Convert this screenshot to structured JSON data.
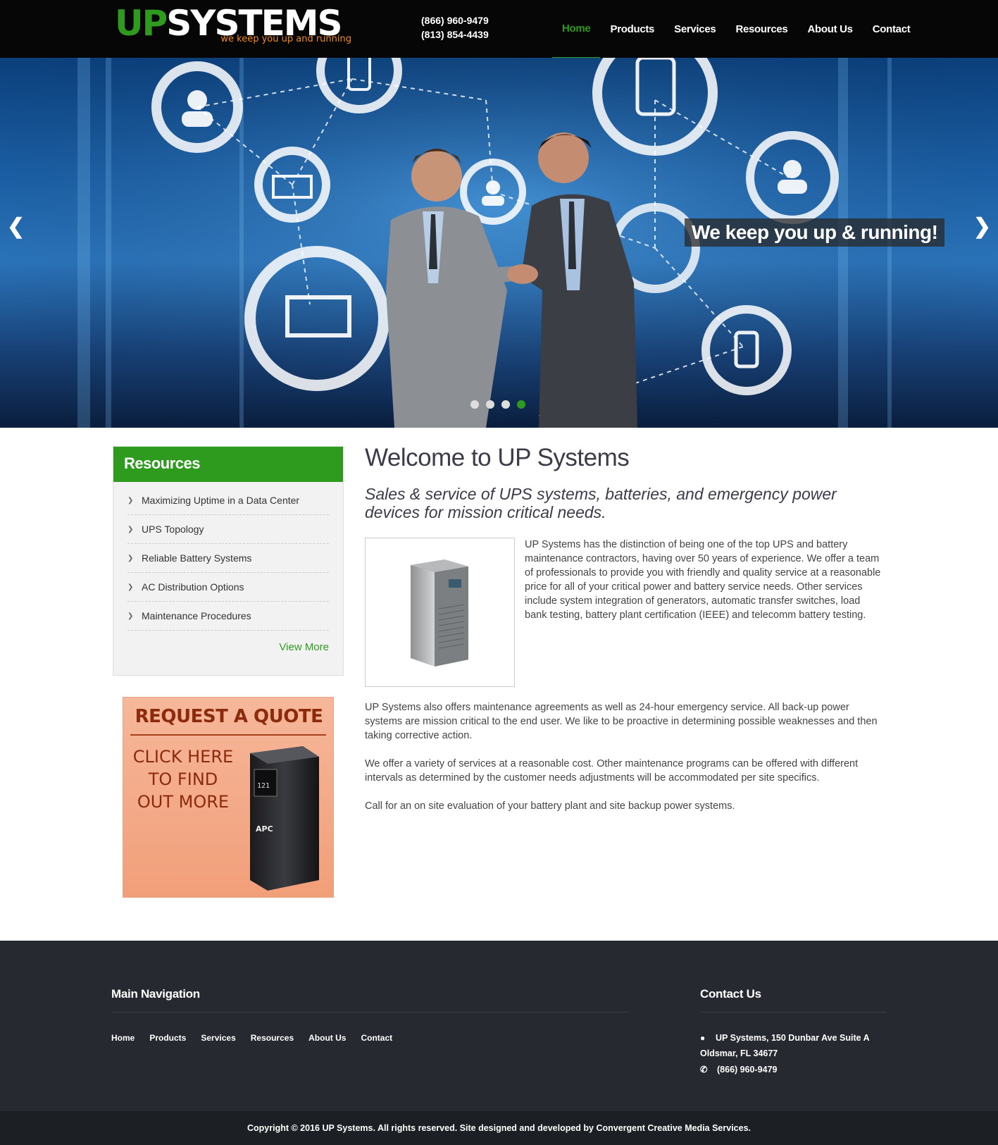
{
  "header": {
    "logo_up": "UP",
    "logo_systems": "SYSTEMS",
    "logo_tagline": "we keep you up and running",
    "phone_1": "(866) 960-9479",
    "phone_2": "(813) 854-4439",
    "nav": [
      "Home",
      "Products",
      "Services",
      "Resources",
      "About Us",
      "Contact"
    ],
    "active_nav": "Home"
  },
  "hero": {
    "caption": "We keep you up & running!",
    "prev_icon": "chevron-left-icon",
    "next_icon": "chevron-right-icon",
    "slide_count": 4,
    "active_slide": 4
  },
  "sidebar": {
    "resources_title": "Resources",
    "resources": [
      "Maximizing Uptime in a Data Center",
      "UPS Topology",
      "Reliable Battery Systems",
      "AC Distribution Options",
      "Maintenance Procedures"
    ],
    "view_more": "View More",
    "quote_title": "REQUEST A QUOTE",
    "quote_cta": "CLICK HERE TO FIND OUT MORE",
    "quote_cta_lines": [
      "CLICK HERE",
      "TO FIND",
      "OUT MORE"
    ]
  },
  "main": {
    "title": "Welcome to UP Systems",
    "subtitle": "Sales & service of UPS systems, batteries, and emergency power devices for mission critical needs.",
    "intro": "UP Systems has the distinction of being one of the top UPS and battery maintenance contractors, having over 50 years of experience. We offer a team of professionals to provide you with friendly and quality service at a reasonable price for all of your critical power and battery service needs. Other services include system integration of generators, automatic transfer switches, load bank testing, battery plant certification (IEEE) and telecomm battery testing.",
    "paragraphs": [
      "UP Systems also offers maintenance agreements as well as 24-hour emergency service. All back-up power systems are mission critical to the end user. We like to be proactive in determining possible weaknesses and then taking corrective action.",
      "We offer a variety of services at a reasonable cost. Other maintenance programs can be offered with different intervals as determined by the customer needs adjustments will be accommodated per site specifics.",
      "Call for an on site evaluation of your battery plant and site backup power systems."
    ]
  },
  "footer": {
    "main_nav_title": "Main Navigation",
    "nav": [
      "Home",
      "Products",
      "Services",
      "Resources",
      "About Us",
      "Contact"
    ],
    "contact_title": "Contact Us",
    "address_line_1": "UP Systems, 150 Dunbar Ave Suite A",
    "address_line_2": "Oldsmar, FL 34677",
    "phone": "(866) 960-9479",
    "copyright": "Copyright © 2016 UP Systems. All rights reserved. Site designed and developed by Convergent Creative Media Services."
  },
  "colors": {
    "brand_green": "#2e9b1e",
    "tagline_orange": "#f08a1c",
    "footer_bg": "#262a30"
  }
}
